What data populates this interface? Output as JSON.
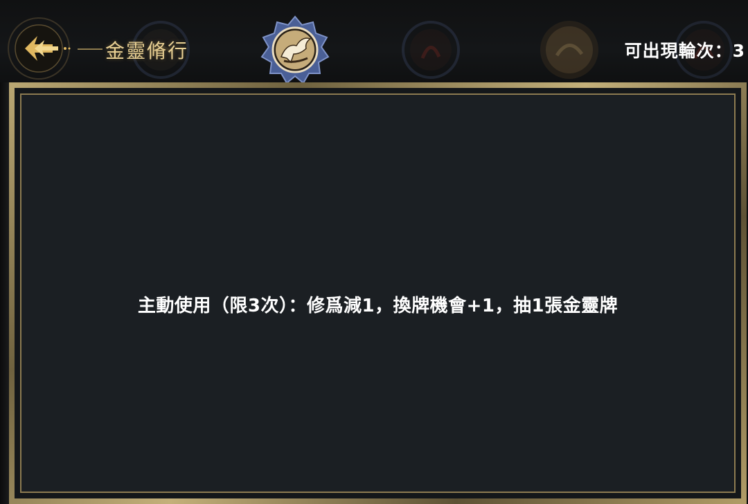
{
  "header": {
    "title": "金靈脩行",
    "rounds_text": "可出現輪次：3",
    "back_icon": "back-arrow-icon",
    "medals": [
      {
        "name": "medal-dim-1",
        "icon": "beast-emblem-icon",
        "active": false
      },
      {
        "name": "medal-active",
        "icon": "dragon-horse-emblem-icon",
        "active": true
      },
      {
        "name": "medal-dim-2",
        "icon": "red-beast-emblem-icon",
        "active": false
      },
      {
        "name": "medal-dim-3",
        "icon": "gold-creature-emblem-icon",
        "active": false
      },
      {
        "name": "medal-dim-4",
        "icon": "red-beast-emblem-icon",
        "active": false
      }
    ]
  },
  "panel": {
    "description": "主動使用（限3次）：修爲減1，換牌機會+1，抽1張金靈牌"
  },
  "colors": {
    "gold": "#e8cf93",
    "panel_bg": "#1b1f23",
    "frame": "#9c8a5e",
    "text": "#ffffff"
  }
}
